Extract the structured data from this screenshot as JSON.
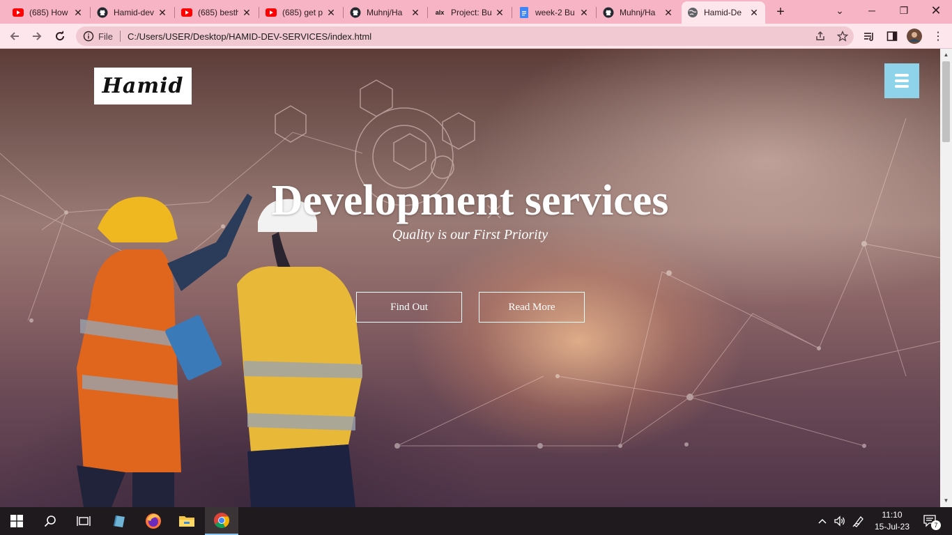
{
  "browser": {
    "tabs": [
      {
        "title": "(685) How",
        "icon": "youtube-icon"
      },
      {
        "title": "Hamid-dev",
        "icon": "github-icon"
      },
      {
        "title": "(685) besth",
        "icon": "youtube-icon"
      },
      {
        "title": "(685) get p",
        "icon": "youtube-icon"
      },
      {
        "title": "Muhnj/Ha",
        "icon": "github-icon"
      },
      {
        "title": "Project: Bu",
        "icon": "alx-icon"
      },
      {
        "title": "week-2 Bu",
        "icon": "docs-icon"
      },
      {
        "title": "Muhnj/Ha",
        "icon": "github-icon"
      },
      {
        "title": "Hamid-De",
        "icon": "globe-icon"
      }
    ],
    "alx_label": "alx",
    "address": {
      "scheme": "File",
      "url": "C:/Users/USER/Desktop/HAMID-DEV-SERVICES/index.html"
    },
    "colors": {
      "tabbar": "#f6b4c4",
      "toolbar": "#fde6ec"
    }
  },
  "page": {
    "logo_text": "Hamid",
    "hero": {
      "title": "Development services",
      "subtitle": "Quality is our First Priority"
    },
    "buttons": {
      "find_out": "Find Out",
      "read_more": "Read More"
    },
    "colors": {
      "menu_button": "#8fd3ea"
    }
  },
  "taskbar": {
    "time": "11:10",
    "date": "15-Jul-23",
    "notification_count": "7"
  }
}
